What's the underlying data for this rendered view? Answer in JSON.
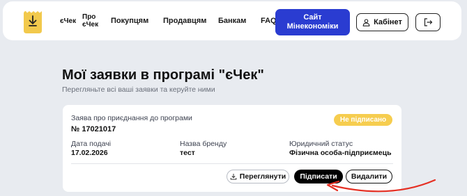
{
  "header": {
    "brand": {
      "line1": "єЧек",
      "line2": "Про",
      "line3": "єЧек"
    },
    "nav": [
      "Покупцям",
      "Продавцям",
      "Банкам",
      "FAQ"
    ],
    "ministry_button": "Сайт\nМінекономіки",
    "cabinet_button": "Кабінет",
    "icons": {
      "logo": "receipt-logo-icon",
      "cabinet": "user-icon",
      "logout": "logout-icon"
    }
  },
  "page": {
    "title": "Мої заявки в програмі \"єЧек\"",
    "subtitle": "Перегляньте всі ваші заявки та керуйте ними"
  },
  "application": {
    "title": "Заява про приєднання до програми",
    "number": "№ 17021017",
    "status": "Не підписано",
    "fields": [
      {
        "label": "Дата подачі",
        "value": "17.02.2026"
      },
      {
        "label": "Назва бренду",
        "value": "тест"
      },
      {
        "label": "Юридичний статус",
        "value": "Фізична особа-підприємець"
      }
    ],
    "actions": {
      "view": "Переглянути",
      "sign": "Підписати",
      "delete": "Видалити"
    }
  },
  "colors": {
    "accent": "#2a3cd1",
    "badge": "#f6cd4f",
    "logo": "#f2c94c",
    "annotation": "#e53024",
    "background": "#e8ebf0"
  }
}
